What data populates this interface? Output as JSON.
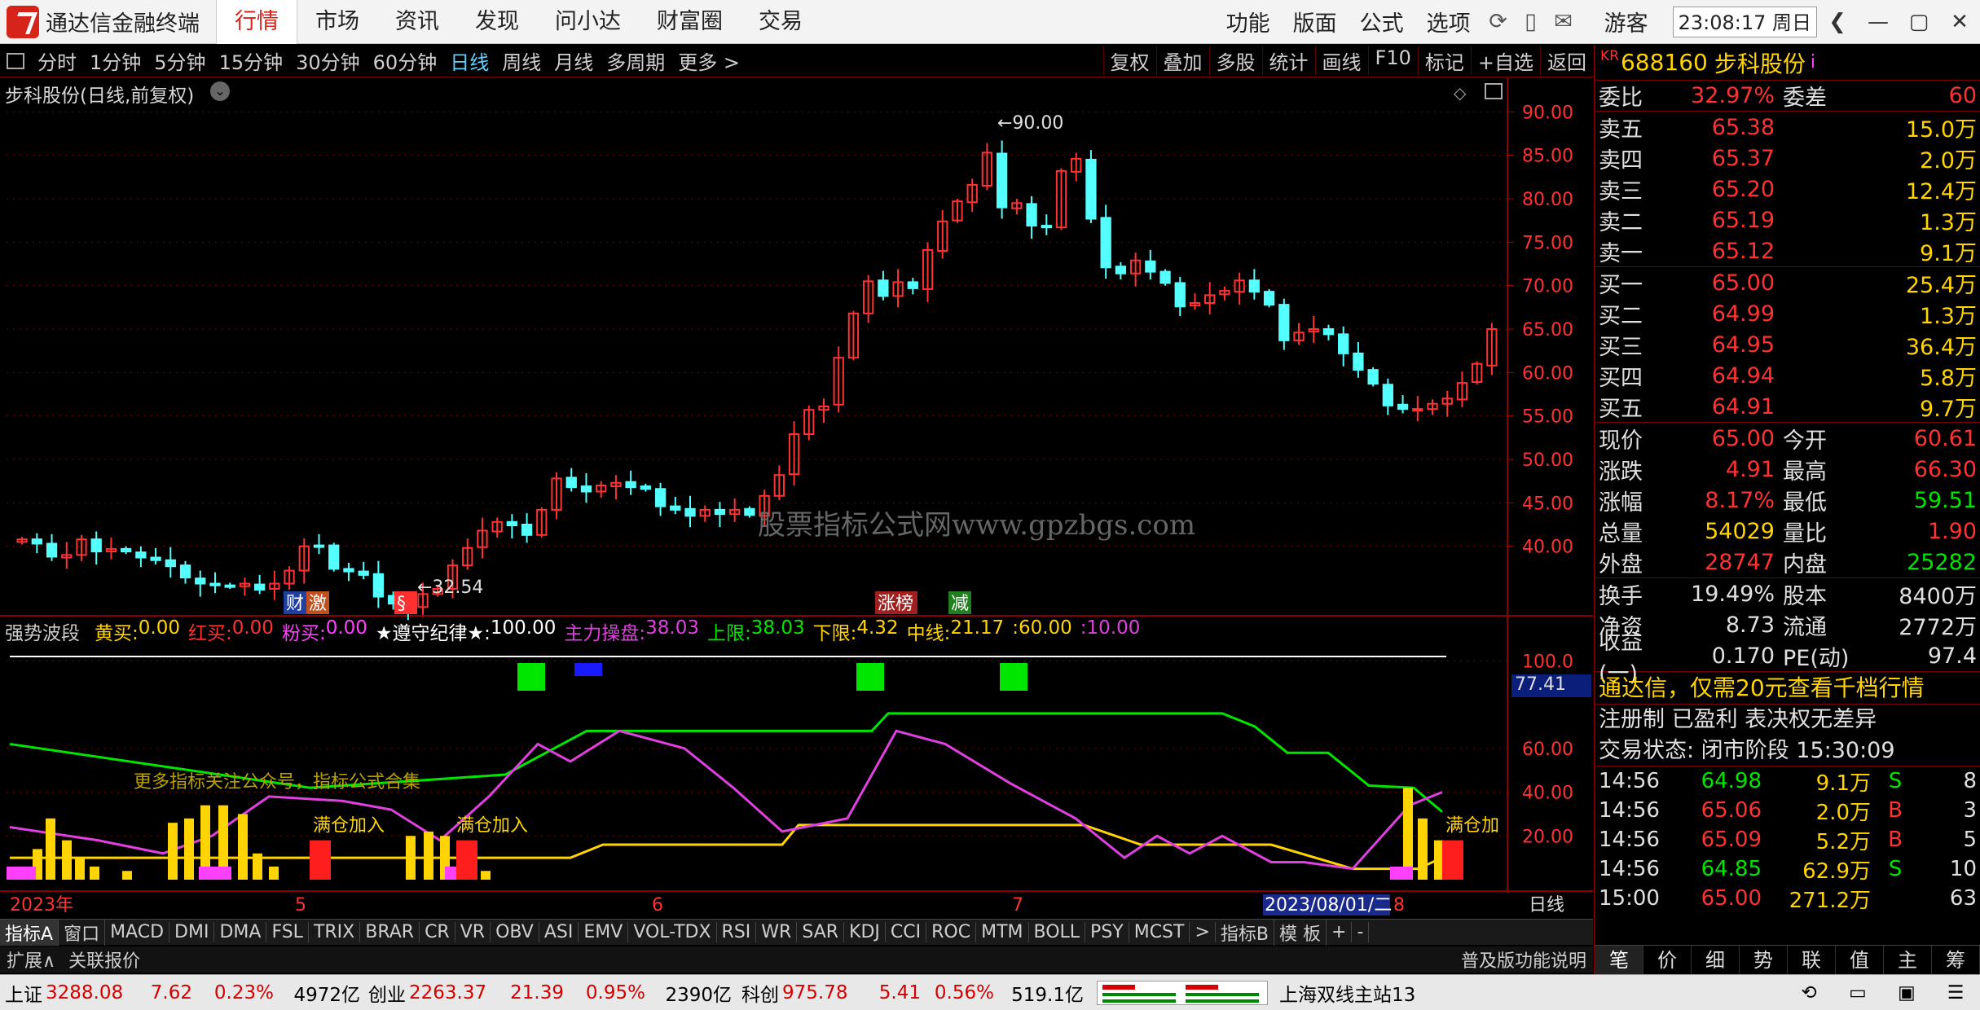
{
  "app": {
    "title": "通达信金融终端",
    "tabs": [
      "行情",
      "市场",
      "资讯",
      "发现",
      "问小达",
      "财富圈",
      "交易"
    ],
    "active_tab": "行情",
    "right_menu": [
      "功能",
      "版面",
      "公式",
      "选项"
    ],
    "guest": "游客",
    "clock": "23:08:17 周日"
  },
  "toolbar": {
    "periods": [
      "分时",
      "1分钟",
      "5分钟",
      "15分钟",
      "30分钟",
      "60分钟",
      "日线",
      "周线",
      "月线",
      "多周期",
      "更多 >"
    ],
    "active_period": "日线",
    "right": [
      "复权",
      "叠加",
      "多股",
      "统计",
      "画线",
      "F10",
      "标记",
      "+自选",
      "返回"
    ]
  },
  "chart_title": "步科股份(日线,前复权)",
  "price_axis": [
    "90.00",
    "85.00",
    "80.00",
    "75.00",
    "70.00",
    "65.00",
    "60.00",
    "55.00",
    "50.00",
    "45.00",
    "40.00"
  ],
  "high_label": "90.00",
  "low_label": "32.54",
  "watermark": "股票指标公式网www.gpzbgs.com",
  "event_tags": [
    {
      "text": "财",
      "color": "#2040a0"
    },
    {
      "text": "激",
      "color": "#c05020"
    },
    {
      "text": "§",
      "color": "#ff3030"
    },
    {
      "text": "涨榜",
      "color": "#a02020"
    },
    {
      "text": "减",
      "color": "#208020"
    }
  ],
  "indicator": {
    "name": "强势波段",
    "items": [
      {
        "k": "黄买:",
        "v": "0.00",
        "c": "#ffd400"
      },
      {
        "k": "红买:",
        "v": "0.00",
        "c": "#ff3030"
      },
      {
        "k": "粉买:",
        "v": "0.00",
        "c": "#ff40ff"
      },
      {
        "k": "★遵守纪律★:",
        "v": "100.00",
        "c": "#ffffff"
      },
      {
        "k": "主力操盘:",
        "v": "38.03",
        "c": "#e040e0"
      },
      {
        "k": "上限:",
        "v": "38.03",
        "c": "#00e600"
      },
      {
        "k": "下限:",
        "v": "4.32",
        "c": "#ffd400"
      },
      {
        "k": "中线:",
        "v": "21.17",
        "c": "#ffd400"
      },
      {
        "k": ":",
        "v": "60.00",
        "c": "#ffd400"
      },
      {
        "k": ":",
        "v": "10.00",
        "c": "#e040e0"
      }
    ],
    "axis": [
      "100.0",
      "60.00",
      "40.00",
      "20.00"
    ],
    "current": "77.41",
    "note": "更多指标关注公众号，指标公式合集",
    "buy_labels": [
      "满仓加入",
      "满仓加入",
      "满仓加"
    ]
  },
  "time_axis": {
    "labels": [
      "2023年",
      "5",
      "6",
      "7",
      "2023/08/01/二",
      "8"
    ],
    "unit": "日线"
  },
  "indicator_tabs": [
    "指标A",
    "窗口",
    "MACD",
    "DMI",
    "DMA",
    "FSL",
    "TRIX",
    "BRAR",
    "CR",
    "VR",
    "OBV",
    "ASI",
    "EMV",
    "VOL-TDX",
    "RSI",
    "WR",
    "SAR",
    "KDJ",
    "CCI",
    "ROC",
    "MTM",
    "BOLL",
    "PSY",
    "MCST",
    ">",
    "指标B",
    "模 板",
    "+",
    "-"
  ],
  "subbar": {
    "left": [
      "扩展∧",
      "关联报价"
    ],
    "right": "普及版功能说明"
  },
  "statusbar": {
    "sh_name": "上证",
    "sh": "3288.08",
    "sh_chg": "7.62",
    "sh_pct": "0.23%",
    "sh_amt": "4972亿",
    "cy_name": "创业",
    "cy": "2263.37",
    "cy_chg": "21.39",
    "cy_pct": "0.95%",
    "cy_amt": "2390亿",
    "kc_name": "科创",
    "kc": "975.78",
    "kc_chg": "5.41",
    "kc_pct": "0.56%",
    "kc_amt": "519.1亿",
    "server": "上海双线主站13"
  },
  "quote": {
    "code": "688160",
    "name": "步科股份",
    "kr": "KR",
    "weibi": [
      "委比",
      "32.97%",
      "委差",
      "60"
    ],
    "sell": [
      [
        "卖五",
        "65.38",
        "15.0万"
      ],
      [
        "卖四",
        "65.37",
        "2.0万"
      ],
      [
        "卖三",
        "65.20",
        "12.4万"
      ],
      [
        "卖二",
        "65.19",
        "1.3万"
      ],
      [
        "卖一",
        "65.12",
        "9.1万"
      ]
    ],
    "buy": [
      [
        "买一",
        "65.00",
        "25.4万"
      ],
      [
        "买二",
        "64.99",
        "1.3万"
      ],
      [
        "买三",
        "64.95",
        "36.4万"
      ],
      [
        "买四",
        "64.94",
        "5.8万"
      ],
      [
        "买五",
        "64.91",
        "9.7万"
      ]
    ],
    "stats": [
      [
        "现价",
        "65.00",
        "今开",
        "60.61"
      ],
      [
        "涨跌",
        "4.91",
        "最高",
        "66.30"
      ],
      [
        "涨幅",
        "8.17%",
        "最低",
        "59.51"
      ],
      [
        "总量",
        "54029",
        "量比",
        "1.90"
      ],
      [
        "外盘",
        "28747",
        "内盘",
        "25282"
      ]
    ],
    "stats2": [
      [
        "换手",
        "19.49%",
        "股本",
        "8400万"
      ],
      [
        "净资",
        "8.73",
        "流通",
        "2772万"
      ],
      [
        "收益(一)",
        "0.170",
        "PE(动)",
        "97.4"
      ]
    ],
    "promo": "通达信，仅需20元查看千档行情",
    "notice": "注册制 已盈利 表决权无差异",
    "trade_status": "交易状态: 闭市阶段 15:30:09",
    "ticks": [
      [
        "14:56",
        "64.98",
        "9.1万",
        "S",
        "8"
      ],
      [
        "14:56",
        "65.06",
        "2.0万",
        "B",
        "3"
      ],
      [
        "14:56",
        "65.09",
        "5.2万",
        "B",
        "5"
      ],
      [
        "14:56",
        "64.85",
        "62.9万",
        "S",
        "10"
      ],
      [
        "15:00",
        "65.00",
        "271.2万",
        "",
        "63"
      ]
    ],
    "tabs": [
      "笔",
      "价",
      "细",
      "势",
      "联",
      "值",
      "主",
      "筹"
    ]
  },
  "chart_data": {
    "type": "candlestick",
    "open": [
      40.5,
      40.8,
      40.3,
      38.7,
      39.0,
      40.8,
      39.4,
      39.7,
      39.3,
      38.7,
      38.4,
      37.8,
      36.3,
      35.7,
      35.5,
      35.4,
      35.6,
      35.1,
      35.7,
      37.2,
      40.1,
      40.1,
      37.4,
      37.1,
      36.8,
      34.3,
      33.4,
      33.0,
      34.5,
      35.1,
      37.8,
      39.9,
      41.7,
      42.8,
      42.5,
      41.3,
      44.2,
      47.9,
      46.9,
      46.3,
      46.9,
      47.4,
      46.9,
      46.6,
      44.6,
      44.3,
      43.5,
      44.2,
      43.7,
      44.3,
      43.5,
      45.8,
      48.3,
      52.9,
      55.7,
      56.3,
      61.7,
      66.8,
      70.6,
      68.8,
      70.4,
      69.6,
      74.0,
      77.5,
      79.6,
      81.5,
      85.2,
      78.9,
      79.4,
      76.9,
      76.7,
      83.1,
      84.5,
      77.8,
      72.2,
      71.4,
      72.8,
      71.6,
      70.3,
      67.7,
      68.0,
      69.0,
      69.3,
      70.6,
      69.3,
      67.8,
      63.7,
      64.7,
      65.0,
      64.4,
      62.2,
      60.3,
      58.6,
      56.3,
      55.7,
      55.8,
      56.4,
      56.9,
      58.9,
      60.8
    ],
    "close": [
      40.8,
      40.3,
      38.8,
      39.0,
      40.8,
      39.4,
      39.7,
      39.4,
      38.7,
      38.4,
      37.7,
      36.4,
      35.7,
      35.5,
      35.4,
      35.7,
      35.0,
      35.7,
      37.2,
      40.0,
      40.0,
      37.4,
      37.1,
      36.7,
      34.2,
      33.4,
      33.0,
      34.5,
      35.1,
      37.8,
      39.8,
      41.8,
      42.8,
      42.4,
      41.3,
      44.2,
      47.8,
      46.8,
      46.3,
      47.0,
      47.3,
      46.8,
      46.6,
      44.6,
      44.2,
      43.5,
      44.2,
      43.7,
      44.2,
      43.6,
      45.8,
      48.2,
      52.9,
      55.7,
      56.1,
      61.7,
      66.8,
      70.5,
      68.8,
      70.4,
      69.7,
      74.1,
      77.4,
      79.7,
      81.6,
      85.3,
      79.0,
      79.5,
      76.9,
      76.7,
      83.2,
      84.6,
      77.7,
      72.1,
      71.4,
      72.9,
      71.6,
      70.3,
      67.6,
      68.0,
      68.9,
      69.4,
      70.6,
      69.3,
      67.8,
      63.7,
      64.6,
      65.0,
      64.4,
      62.2,
      60.3,
      58.7,
      56.2,
      55.8,
      55.8,
      56.4,
      57.0,
      58.8,
      61.0,
      65.0
    ],
    "ylim": [
      32,
      92
    ]
  }
}
